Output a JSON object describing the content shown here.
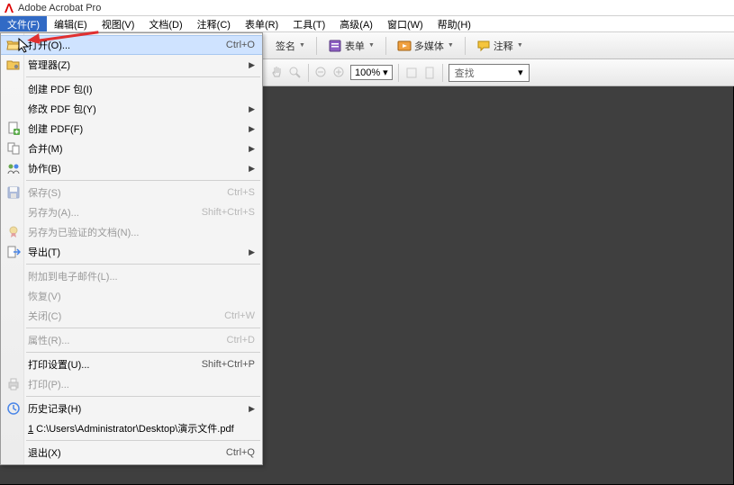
{
  "title": "Adobe Acrobat Pro",
  "menubar": [
    {
      "label": "文件(F)",
      "active": true
    },
    {
      "label": "编辑(E)"
    },
    {
      "label": "视图(V)"
    },
    {
      "label": "文档(D)"
    },
    {
      "label": "注释(C)"
    },
    {
      "label": "表单(R)"
    },
    {
      "label": "工具(T)"
    },
    {
      "label": "高级(A)"
    },
    {
      "label": "窗口(W)"
    },
    {
      "label": "帮助(H)"
    }
  ],
  "toolbar1": {
    "sign_label": "签名",
    "forms_label": "表单",
    "multimedia_label": "多媒体",
    "comment_label": "注释"
  },
  "toolbar2": {
    "zoom_value": "100%",
    "search_placeholder": "查找"
  },
  "file_menu": [
    {
      "kind": "item",
      "icon": "folder-open",
      "label": "打开(O)...",
      "shortcut": "Ctrl+O",
      "highlight": true
    },
    {
      "kind": "item",
      "icon": "folder-gear",
      "label": "管理器(Z)",
      "submenu": true
    },
    {
      "kind": "sep"
    },
    {
      "kind": "item",
      "label": "创建 PDF 包(I)"
    },
    {
      "kind": "item",
      "label": "修改 PDF 包(Y)",
      "submenu": true
    },
    {
      "kind": "item",
      "icon": "doc-new",
      "label": "创建 PDF(F)",
      "submenu": true
    },
    {
      "kind": "item",
      "icon": "merge",
      "label": "合并(M)",
      "submenu": true
    },
    {
      "kind": "item",
      "icon": "collab",
      "label": "协作(B)",
      "submenu": true
    },
    {
      "kind": "sep"
    },
    {
      "kind": "item",
      "icon": "save",
      "label": "保存(S)",
      "shortcut": "Ctrl+S",
      "disabled": true
    },
    {
      "kind": "item",
      "label": "另存为(A)...",
      "shortcut": "Shift+Ctrl+S",
      "disabled": true
    },
    {
      "kind": "item",
      "icon": "cert",
      "label": "另存为已验证的文档(N)...",
      "disabled": true
    },
    {
      "kind": "item",
      "icon": "export",
      "label": "导出(T)",
      "submenu": true
    },
    {
      "kind": "sep"
    },
    {
      "kind": "item",
      "label": "附加到电子邮件(L)...",
      "disabled": true
    },
    {
      "kind": "item",
      "label": "恢复(V)",
      "disabled": true
    },
    {
      "kind": "item",
      "label": "关闭(C)",
      "shortcut": "Ctrl+W",
      "disabled": true
    },
    {
      "kind": "sep"
    },
    {
      "kind": "item",
      "label": "属性(R)...",
      "shortcut": "Ctrl+D",
      "disabled": true
    },
    {
      "kind": "sep"
    },
    {
      "kind": "item",
      "label": "打印设置(U)...",
      "shortcut": "Shift+Ctrl+P"
    },
    {
      "kind": "item",
      "icon": "print",
      "label": "打印(P)...",
      "disabled": true
    },
    {
      "kind": "sep"
    },
    {
      "kind": "item",
      "icon": "history",
      "label": "历史记录(H)",
      "submenu": true
    },
    {
      "kind": "item",
      "label": "1 C:\\Users\\Administrator\\Desktop\\演示文件.pdf",
      "underline_first": true
    },
    {
      "kind": "sep"
    },
    {
      "kind": "item",
      "label": "退出(X)",
      "shortcut": "Ctrl+Q"
    }
  ]
}
